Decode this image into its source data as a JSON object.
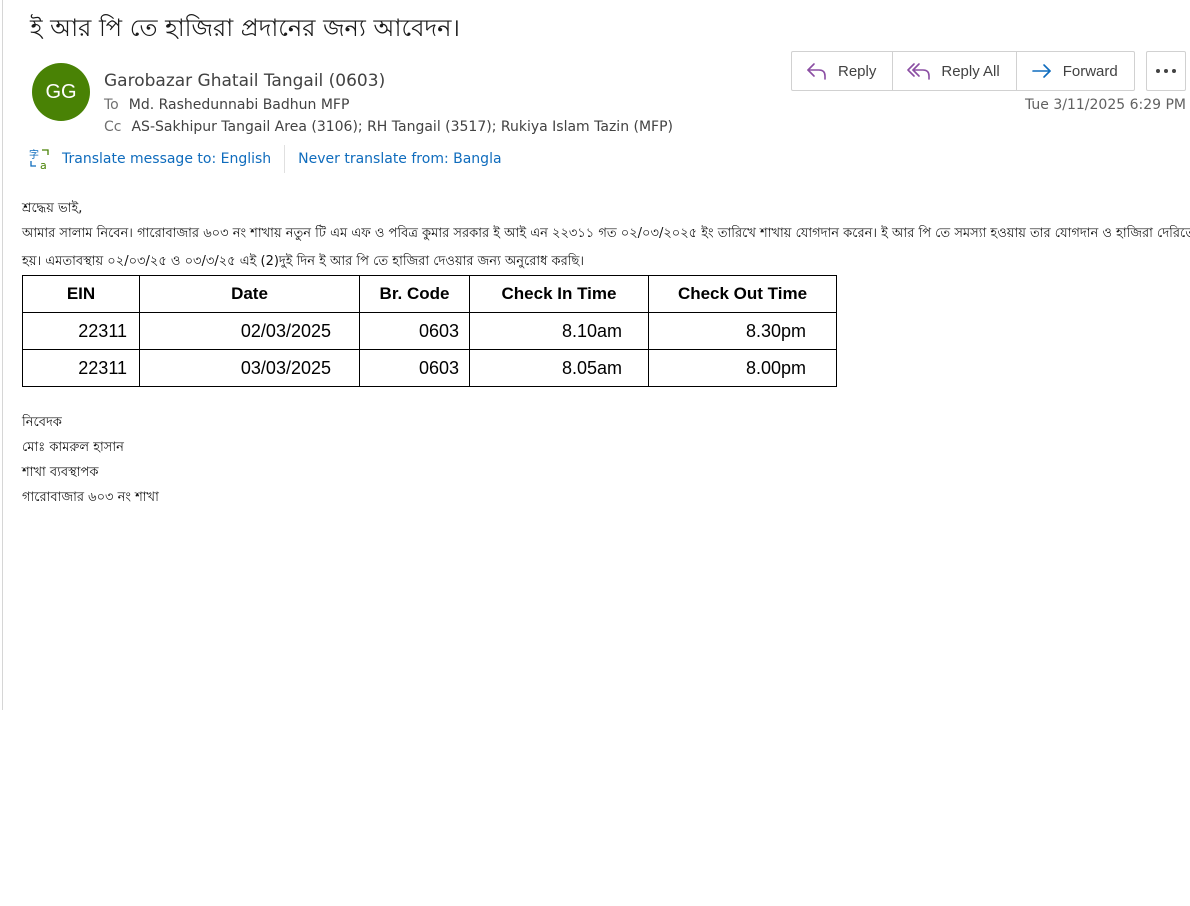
{
  "email": {
    "subject": "ই আর পি তে হাজিরা প্রদানের জন্য আবেদন।",
    "avatar_initials": "GG",
    "avatar_color": "#498205",
    "sender": "Garobazar  Ghatail Tangail (0603)",
    "to_label": "To",
    "to_value": "Md. Rashedunnabi Badhun MFP",
    "cc_label": "Cc",
    "cc_value": "AS-Sakhipur Tangail Area (3106); RH Tangail (3517); Rukiya Islam Tazin (MFP)",
    "datetime": "Tue 3/11/2025 6:29 PM"
  },
  "actions": {
    "reply": "Reply",
    "reply_all": "Reply All",
    "forward": "Forward",
    "more_icon": "more-horizontal-icon",
    "accent_color": "#8b4ea3"
  },
  "translate": {
    "icon": "translate-icon",
    "translate_label": "Translate message to: English",
    "never_label": "Never translate from: Bangla",
    "link_color": "#0f6cbd"
  },
  "body": {
    "greeting": "শ্রদ্ধেয়  ভাই,",
    "para1": "আমার সালাম নিবেন। গারোবাজার ৬০৩ নং শাখায় নতুন টি এম এফ ও পবিত্র কুমার সরকার ই আই এন ২২৩১১ গত ০২/০৩/২০২৫ ইং তারিখে শাখায় যোগদান করেন। ই আর পি তে সমস্যা হওয়ায় তার যোগদান ও হাজিরা দেরিতে",
    "para2": "হয়। এমতাবস্থায় ০২/০৩/২৫ ও ০৩/৩/২৫  এই (2)দুই দিন ই আর পি তে হাজিরা দেওয়ার জন্য অনুরোধ করছি।"
  },
  "table": {
    "headers": [
      "EIN",
      "Date",
      "Br. Code",
      "Check In Time",
      "Check Out Time"
    ],
    "rows": [
      [
        "22311",
        "02/03/2025",
        "0603",
        "8.10am",
        "8.30pm"
      ],
      [
        "22311",
        "03/03/2025",
        "0603",
        "8.05am",
        "8.00pm"
      ]
    ]
  },
  "signature": {
    "line1": "নিবেদক",
    "line2": "মোঃ কামরুল হাসান",
    "line3": "শাখা ব্যবস্থাপক",
    "line4": "গারোবাজার ৬০৩ নং শাখা"
  }
}
